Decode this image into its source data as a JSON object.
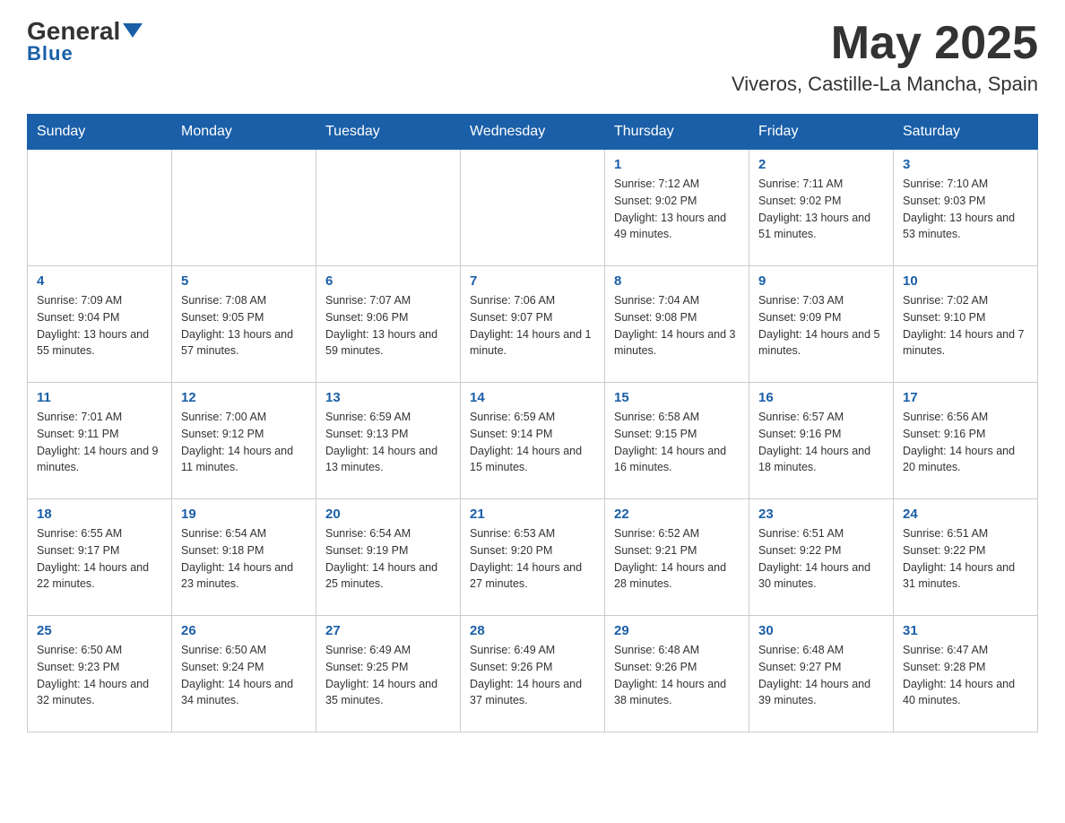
{
  "header": {
    "logo_general": "General",
    "logo_blue": "Blue",
    "month_title": "May 2025",
    "location": "Viveros, Castille-La Mancha, Spain"
  },
  "days_of_week": [
    "Sunday",
    "Monday",
    "Tuesday",
    "Wednesday",
    "Thursday",
    "Friday",
    "Saturday"
  ],
  "weeks": [
    [
      {
        "day": "",
        "info": ""
      },
      {
        "day": "",
        "info": ""
      },
      {
        "day": "",
        "info": ""
      },
      {
        "day": "",
        "info": ""
      },
      {
        "day": "1",
        "info": "Sunrise: 7:12 AM\nSunset: 9:02 PM\nDaylight: 13 hours and 49 minutes."
      },
      {
        "day": "2",
        "info": "Sunrise: 7:11 AM\nSunset: 9:02 PM\nDaylight: 13 hours and 51 minutes."
      },
      {
        "day": "3",
        "info": "Sunrise: 7:10 AM\nSunset: 9:03 PM\nDaylight: 13 hours and 53 minutes."
      }
    ],
    [
      {
        "day": "4",
        "info": "Sunrise: 7:09 AM\nSunset: 9:04 PM\nDaylight: 13 hours and 55 minutes."
      },
      {
        "day": "5",
        "info": "Sunrise: 7:08 AM\nSunset: 9:05 PM\nDaylight: 13 hours and 57 minutes."
      },
      {
        "day": "6",
        "info": "Sunrise: 7:07 AM\nSunset: 9:06 PM\nDaylight: 13 hours and 59 minutes."
      },
      {
        "day": "7",
        "info": "Sunrise: 7:06 AM\nSunset: 9:07 PM\nDaylight: 14 hours and 1 minute."
      },
      {
        "day": "8",
        "info": "Sunrise: 7:04 AM\nSunset: 9:08 PM\nDaylight: 14 hours and 3 minutes."
      },
      {
        "day": "9",
        "info": "Sunrise: 7:03 AM\nSunset: 9:09 PM\nDaylight: 14 hours and 5 minutes."
      },
      {
        "day": "10",
        "info": "Sunrise: 7:02 AM\nSunset: 9:10 PM\nDaylight: 14 hours and 7 minutes."
      }
    ],
    [
      {
        "day": "11",
        "info": "Sunrise: 7:01 AM\nSunset: 9:11 PM\nDaylight: 14 hours and 9 minutes."
      },
      {
        "day": "12",
        "info": "Sunrise: 7:00 AM\nSunset: 9:12 PM\nDaylight: 14 hours and 11 minutes."
      },
      {
        "day": "13",
        "info": "Sunrise: 6:59 AM\nSunset: 9:13 PM\nDaylight: 14 hours and 13 minutes."
      },
      {
        "day": "14",
        "info": "Sunrise: 6:59 AM\nSunset: 9:14 PM\nDaylight: 14 hours and 15 minutes."
      },
      {
        "day": "15",
        "info": "Sunrise: 6:58 AM\nSunset: 9:15 PM\nDaylight: 14 hours and 16 minutes."
      },
      {
        "day": "16",
        "info": "Sunrise: 6:57 AM\nSunset: 9:16 PM\nDaylight: 14 hours and 18 minutes."
      },
      {
        "day": "17",
        "info": "Sunrise: 6:56 AM\nSunset: 9:16 PM\nDaylight: 14 hours and 20 minutes."
      }
    ],
    [
      {
        "day": "18",
        "info": "Sunrise: 6:55 AM\nSunset: 9:17 PM\nDaylight: 14 hours and 22 minutes."
      },
      {
        "day": "19",
        "info": "Sunrise: 6:54 AM\nSunset: 9:18 PM\nDaylight: 14 hours and 23 minutes."
      },
      {
        "day": "20",
        "info": "Sunrise: 6:54 AM\nSunset: 9:19 PM\nDaylight: 14 hours and 25 minutes."
      },
      {
        "day": "21",
        "info": "Sunrise: 6:53 AM\nSunset: 9:20 PM\nDaylight: 14 hours and 27 minutes."
      },
      {
        "day": "22",
        "info": "Sunrise: 6:52 AM\nSunset: 9:21 PM\nDaylight: 14 hours and 28 minutes."
      },
      {
        "day": "23",
        "info": "Sunrise: 6:51 AM\nSunset: 9:22 PM\nDaylight: 14 hours and 30 minutes."
      },
      {
        "day": "24",
        "info": "Sunrise: 6:51 AM\nSunset: 9:22 PM\nDaylight: 14 hours and 31 minutes."
      }
    ],
    [
      {
        "day": "25",
        "info": "Sunrise: 6:50 AM\nSunset: 9:23 PM\nDaylight: 14 hours and 32 minutes."
      },
      {
        "day": "26",
        "info": "Sunrise: 6:50 AM\nSunset: 9:24 PM\nDaylight: 14 hours and 34 minutes."
      },
      {
        "day": "27",
        "info": "Sunrise: 6:49 AM\nSunset: 9:25 PM\nDaylight: 14 hours and 35 minutes."
      },
      {
        "day": "28",
        "info": "Sunrise: 6:49 AM\nSunset: 9:26 PM\nDaylight: 14 hours and 37 minutes."
      },
      {
        "day": "29",
        "info": "Sunrise: 6:48 AM\nSunset: 9:26 PM\nDaylight: 14 hours and 38 minutes."
      },
      {
        "day": "30",
        "info": "Sunrise: 6:48 AM\nSunset: 9:27 PM\nDaylight: 14 hours and 39 minutes."
      },
      {
        "day": "31",
        "info": "Sunrise: 6:47 AM\nSunset: 9:28 PM\nDaylight: 14 hours and 40 minutes."
      }
    ]
  ]
}
